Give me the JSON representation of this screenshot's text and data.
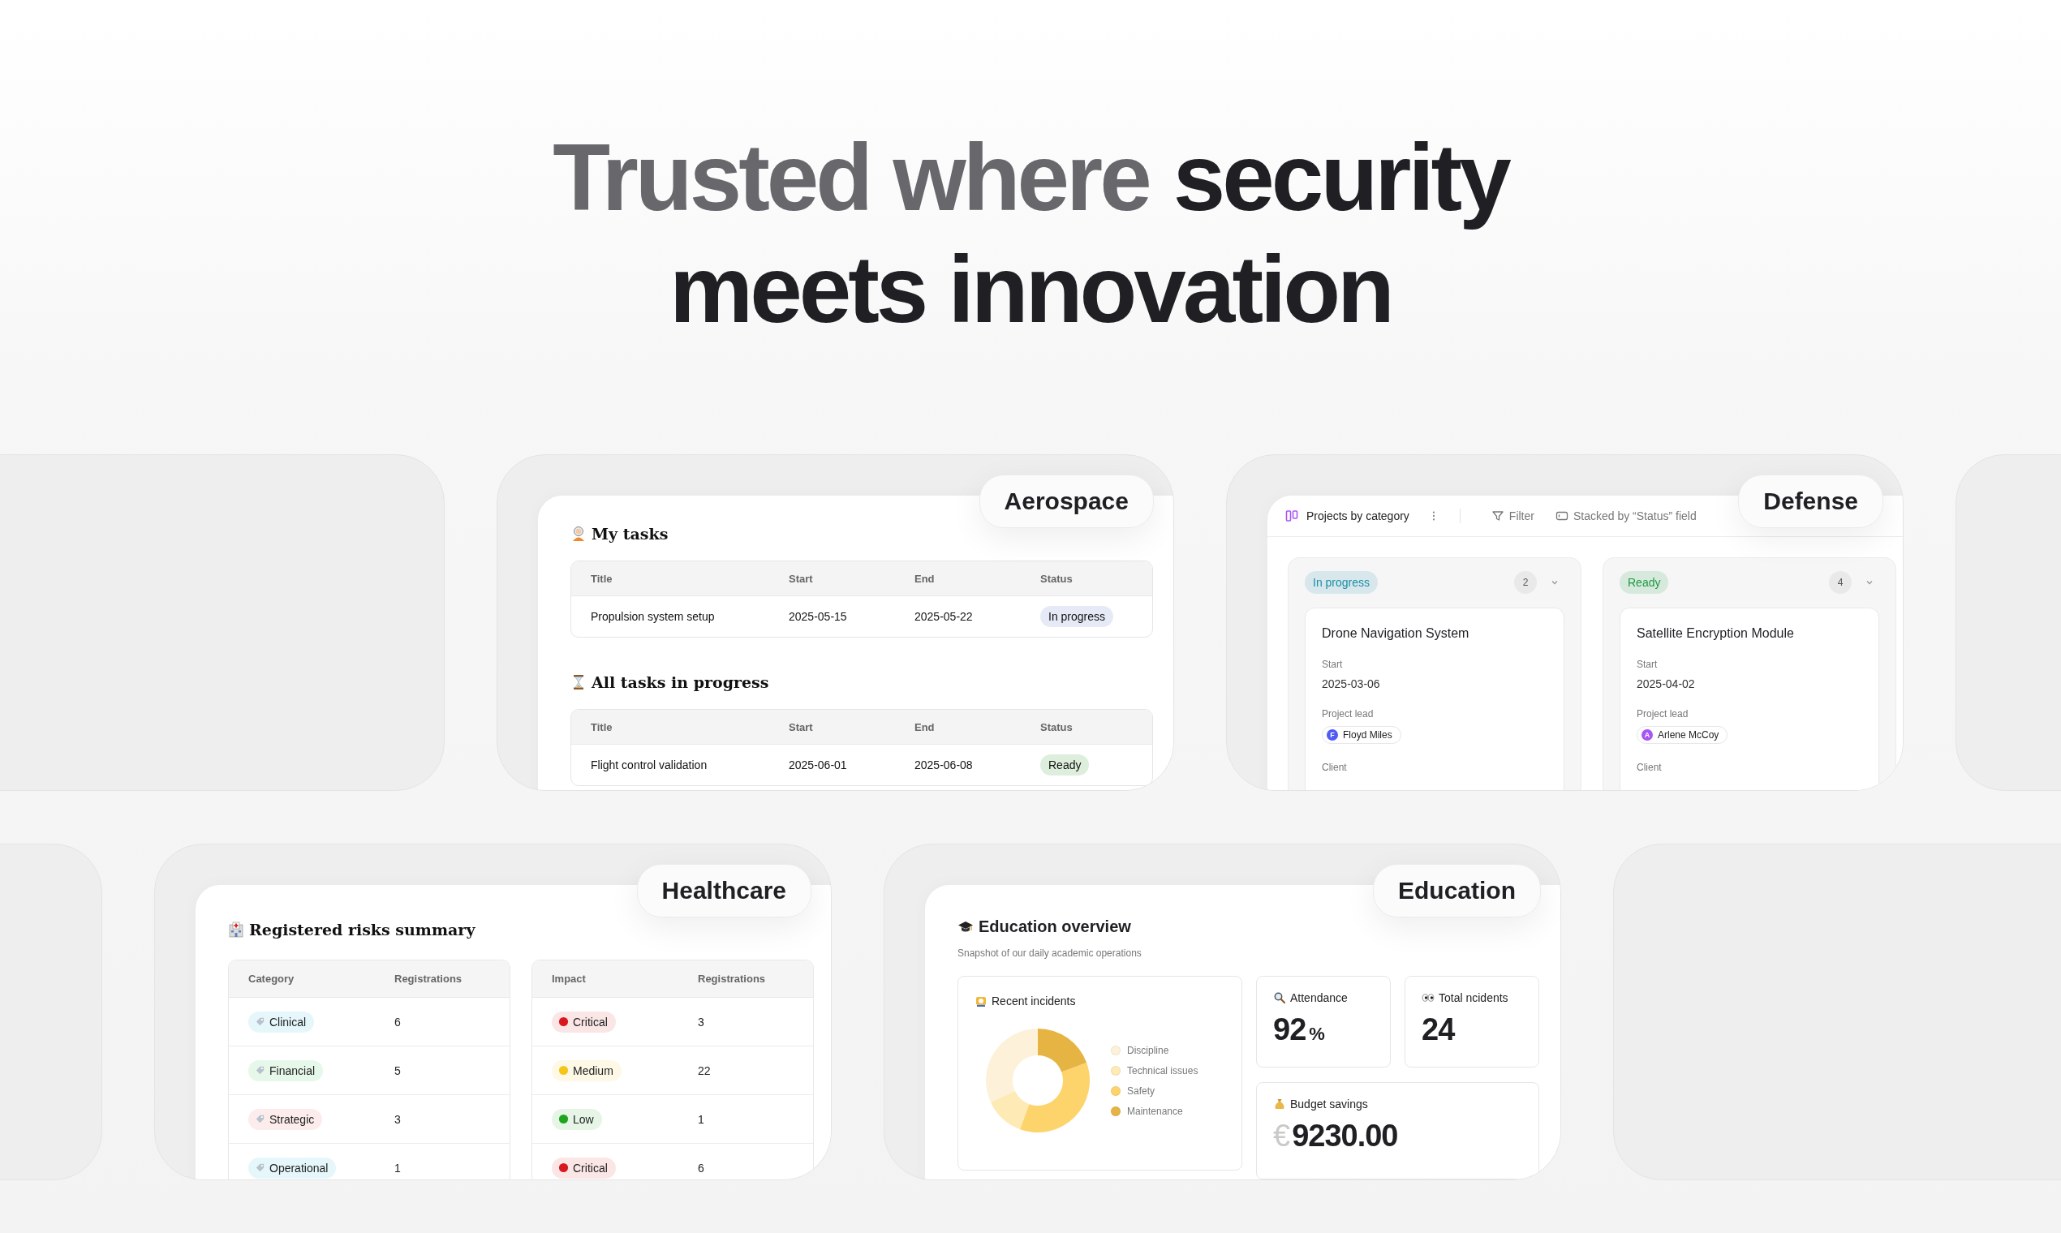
{
  "headline": {
    "lines": [
      [
        {
          "text": "Trusted where",
          "muted": true
        },
        {
          "text": "security",
          "muted": false
        }
      ],
      [
        {
          "text": "meets innovation",
          "muted": false
        }
      ]
    ]
  },
  "aerospace": {
    "label": "Aerospace",
    "sections": [
      {
        "title": "My tasks",
        "columns": [
          "Title",
          "Start",
          "End",
          "Status"
        ],
        "rows": [
          {
            "title": "Propulsion system setup",
            "start": "2025-05-15",
            "end": "2025-05-22",
            "status": "In progress",
            "color": "#e6eaf6"
          }
        ]
      },
      {
        "title": "All tasks in progress",
        "columns": [
          "Title",
          "Start",
          "End",
          "Status"
        ],
        "rows": [
          {
            "title": "Flight control validation",
            "start": "2025-06-01",
            "end": "2025-06-08",
            "status": "Ready",
            "color": "#ddefdc"
          }
        ]
      }
    ]
  },
  "defense": {
    "label": "Defense",
    "toolbar": {
      "view": "Projects by category",
      "filter": "Filter",
      "stacked": "Stacked by “Status” field"
    },
    "columns": [
      {
        "status": "In progress",
        "color": "#1b8fa8",
        "count": "2",
        "card": {
          "title": "Drone Navigation System",
          "start_label": "Start",
          "start": "2025-03-06",
          "lead_label": "Project lead",
          "lead": {
            "initial": "F",
            "name": "Floyd Miles",
            "color": "#4f5bf5"
          },
          "client_label": "Client"
        }
      },
      {
        "status": "Ready",
        "color": "#1d9a43",
        "count": "4",
        "card": {
          "title": "Satellite Encryption Module",
          "start_label": "Start",
          "start": "2025-04-02",
          "lead_label": "Project lead",
          "lead": {
            "initial": "A",
            "name": "Arlene McCoy",
            "color": "#a855f7"
          },
          "client_label": "Client"
        }
      }
    ]
  },
  "healthcare": {
    "label": "Healthcare",
    "title": "Registered risks summary",
    "category_table": {
      "columns": [
        "Category",
        "Registrations"
      ],
      "rows": [
        {
          "name": "Clinical",
          "count": "6",
          "color": "#e6f7fc"
        },
        {
          "name": "Financial",
          "count": "5",
          "color": "#e6f8ea"
        },
        {
          "name": "Strategic",
          "count": "3",
          "color": "#fdecec"
        },
        {
          "name": "Operational",
          "count": "1",
          "color": "#e6f7fc"
        }
      ]
    },
    "impact_table": {
      "columns": [
        "Impact",
        "Registrations"
      ],
      "rows": [
        {
          "name": "Critical",
          "count": "3",
          "color": "#d7191f"
        },
        {
          "name": "Medium",
          "count": "22",
          "color": "#f5c518"
        },
        {
          "name": "Low",
          "count": "1",
          "color": "#1ea51e"
        },
        {
          "name": "Critical",
          "count": "6",
          "color": "#d7191f"
        }
      ]
    }
  },
  "education": {
    "label": "Education",
    "title": "Education overview",
    "subtitle": "Snapshot of our daily academic operations",
    "incidents": {
      "title": "Recent incidents",
      "legend": [
        {
          "name": "Discipline",
          "color": "#fdf2d9"
        },
        {
          "name": "Technical issues",
          "color": "#feeab5"
        },
        {
          "name": "Safety",
          "color": "#fdd46c"
        },
        {
          "name": "Maintenance",
          "color": "#e6b443"
        }
      ]
    },
    "attendance": {
      "title": "Attendance",
      "value": "92",
      "unit": "%"
    },
    "total": {
      "title": "Total ncidents",
      "value": "24"
    },
    "budget": {
      "title": "Budget savings",
      "currency": "€",
      "value": "9230.00"
    }
  }
}
